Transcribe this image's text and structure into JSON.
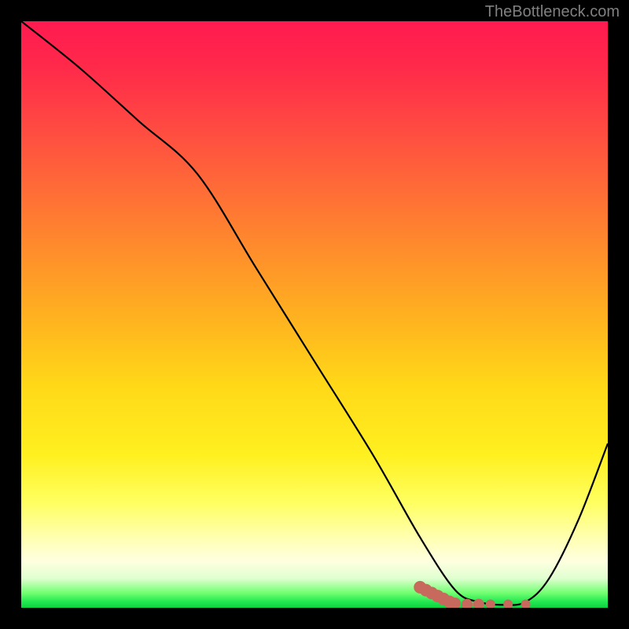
{
  "attribution": "TheBottleneck.com",
  "chart_data": {
    "type": "line",
    "title": "",
    "xlabel": "",
    "ylabel": "",
    "xlim": [
      0,
      100
    ],
    "ylim": [
      0,
      100
    ],
    "series": [
      {
        "name": "bottleneck-curve",
        "x": [
          0,
          10,
          20,
          30,
          40,
          50,
          60,
          68,
          74,
          78,
          82,
          86,
          90,
          95,
          100
        ],
        "y": [
          100,
          92,
          83,
          74,
          58,
          42,
          26,
          12,
          3,
          1,
          0.5,
          1,
          5,
          15,
          28
        ]
      }
    ],
    "scatter_points": {
      "name": "highlighted-region",
      "points": [
        {
          "x": 68,
          "y": 3.5
        },
        {
          "x": 69,
          "y": 3.0
        },
        {
          "x": 70,
          "y": 2.5
        },
        {
          "x": 71,
          "y": 2.0
        },
        {
          "x": 72,
          "y": 1.5
        },
        {
          "x": 73,
          "y": 1.0
        },
        {
          "x": 74,
          "y": 0.8
        },
        {
          "x": 76,
          "y": 0.6
        },
        {
          "x": 78,
          "y": 0.6
        },
        {
          "x": 80,
          "y": 0.6
        },
        {
          "x": 83,
          "y": 0.6
        },
        {
          "x": 86,
          "y": 0.6
        }
      ],
      "color": "#c8695e"
    },
    "background_gradient": {
      "top": "#ff1a50",
      "middle": "#ffd020",
      "bottom": "#20e850"
    }
  }
}
